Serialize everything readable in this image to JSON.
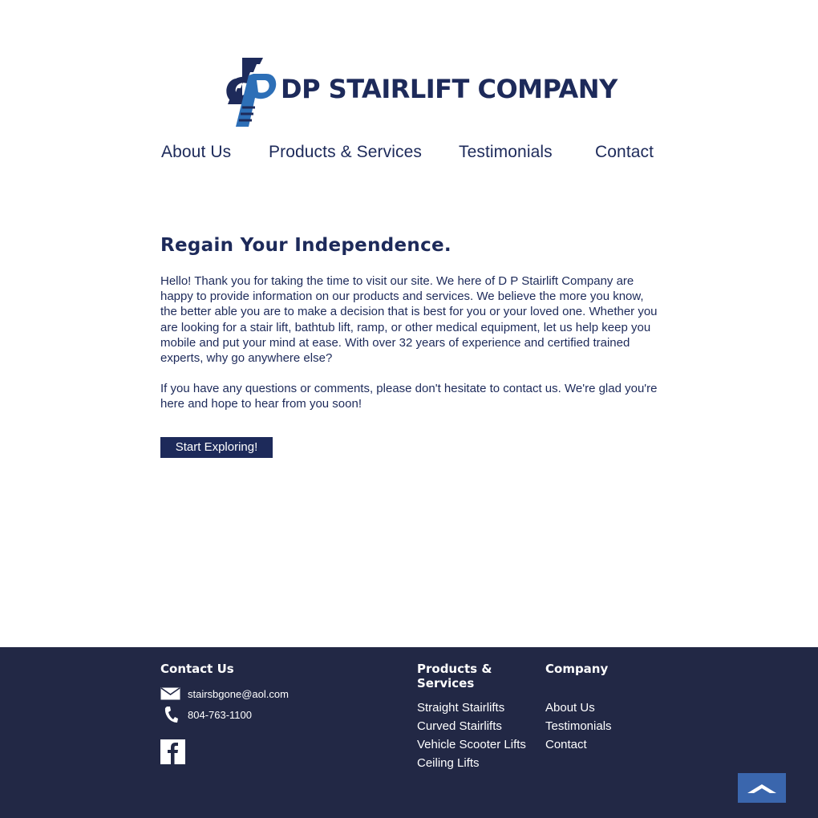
{
  "logo": {
    "text": "DP STAIRLIFT COMPANY"
  },
  "nav": {
    "items": [
      {
        "label": "About Us"
      },
      {
        "label": "Products & Services"
      },
      {
        "label": "Testimonials"
      },
      {
        "label": "Contact"
      }
    ]
  },
  "main": {
    "headline": "Regain Your Independence.",
    "paragraph1": "Hello! Thank you for taking the time to visit our site. We here of D P Stairlift Company are happy to provide information on our products and services. We believe the more you know, the better able you are to make a decision that is best for you or your loved one. Whether you are looking for a stair lift, bathtub lift, ramp, or other medical equipment, let us help keep you mobile and put your mind at ease. With over 32 years of experience and certified trained experts, why go anywhere else?",
    "paragraph2": "If you have any questions or comments, please don't hesitate to contact us. We're glad you're here and hope to hear from you soon!",
    "cta_label": "Start Exploring!"
  },
  "footer": {
    "contact": {
      "title": "Contact Us",
      "email": "stairsbgone@aol.com",
      "phone": "804-763-1100",
      "email_icon": "envelope-icon",
      "phone_icon": "phone-icon",
      "social_icon": "facebook-icon"
    },
    "products": {
      "title": "Products & Services",
      "links": [
        "Straight Stairlifts",
        "Curved Stairlifts",
        "Vehicle Scooter Lifts",
        "Ceiling Lifts"
      ]
    },
    "company": {
      "title": "Company",
      "links": [
        "About Us",
        "Testimonials",
        "Contact"
      ]
    },
    "back_to_top_icon": "chevron-up-icon"
  },
  "colors": {
    "navy": "#1d2a5a",
    "footer_bg": "#222845",
    "accent_blue": "#3a66ad",
    "logo_blue": "#2d6fb7"
  }
}
